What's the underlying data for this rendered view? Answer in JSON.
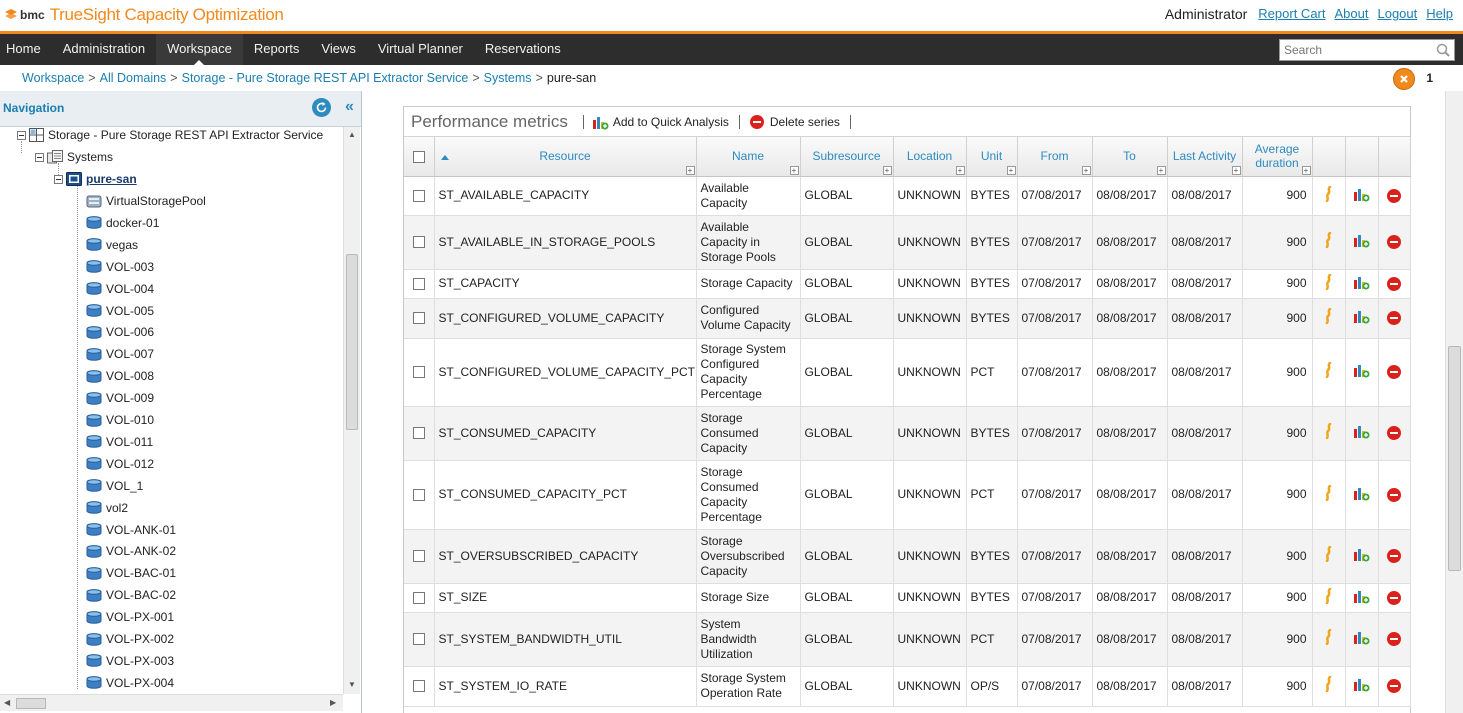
{
  "app": {
    "brand": "bmc",
    "product": "TrueSight Capacity Optimization",
    "user": "Administrator",
    "links": [
      "Report Cart",
      "About",
      "Logout",
      "Help"
    ]
  },
  "menu": {
    "items": [
      "Home",
      "Administration",
      "Workspace",
      "Reports",
      "Views",
      "Virtual Planner",
      "Reservations"
    ],
    "active": "Workspace",
    "search_placeholder": "Search"
  },
  "breadcrumb": {
    "items": [
      "Workspace",
      "All Domains",
      "Storage - Pure Storage REST API Extractor Service",
      "Systems"
    ],
    "current": "pure-san",
    "close_count": "1"
  },
  "nav": {
    "title": "Navigation",
    "domain": "Storage - Pure Storage REST API Extractor Service",
    "systems": "Systems",
    "selected": "pure-san",
    "children": [
      "VirtualStoragePool",
      "docker-01",
      "vegas",
      "VOL-003",
      "VOL-004",
      "VOL-005",
      "VOL-006",
      "VOL-007",
      "VOL-008",
      "VOL-009",
      "VOL-010",
      "VOL-011",
      "VOL-012",
      "VOL_1",
      "vol2",
      "VOL-ANK-01",
      "VOL-ANK-02",
      "VOL-BAC-01",
      "VOL-BAC-02",
      "VOL-PX-001",
      "VOL-PX-002",
      "VOL-PX-003",
      "VOL-PX-004"
    ]
  },
  "panel": {
    "title": "Performance metrics",
    "add_to_quick_analysis": "Add to Quick Analysis",
    "delete_series": "Delete series"
  },
  "table": {
    "headers": {
      "resource": "Resource",
      "name": "Name",
      "subresource": "Subresource",
      "location": "Location",
      "unit": "Unit",
      "from": "From",
      "to": "To",
      "last_activity": "Last Activity",
      "average_duration": "Average duration"
    },
    "rows": [
      {
        "resource": "ST_AVAILABLE_CAPACITY",
        "name": "Available Capacity",
        "subresource": "GLOBAL",
        "location": "UNKNOWN",
        "unit": "BYTES",
        "from": "07/08/2017",
        "to": "08/08/2017",
        "last": "08/08/2017",
        "dur": "900"
      },
      {
        "resource": "ST_AVAILABLE_IN_STORAGE_POOLS",
        "name": "Available Capacity in Storage Pools",
        "subresource": "GLOBAL",
        "location": "UNKNOWN",
        "unit": "BYTES",
        "from": "07/08/2017",
        "to": "08/08/2017",
        "last": "08/08/2017",
        "dur": "900"
      },
      {
        "resource": "ST_CAPACITY",
        "name": "Storage Capacity",
        "subresource": "GLOBAL",
        "location": "UNKNOWN",
        "unit": "BYTES",
        "from": "07/08/2017",
        "to": "08/08/2017",
        "last": "08/08/2017",
        "dur": "900"
      },
      {
        "resource": "ST_CONFIGURED_VOLUME_CAPACITY",
        "name": "Configured Volume Capacity",
        "subresource": "GLOBAL",
        "location": "UNKNOWN",
        "unit": "BYTES",
        "from": "07/08/2017",
        "to": "08/08/2017",
        "last": "08/08/2017",
        "dur": "900"
      },
      {
        "resource": "ST_CONFIGURED_VOLUME_CAPACITY_PCT",
        "name": "Storage System Configured Capacity Percentage",
        "subresource": "GLOBAL",
        "location": "UNKNOWN",
        "unit": "PCT",
        "from": "07/08/2017",
        "to": "08/08/2017",
        "last": "08/08/2017",
        "dur": "900"
      },
      {
        "resource": "ST_CONSUMED_CAPACITY",
        "name": "Storage Consumed Capacity",
        "subresource": "GLOBAL",
        "location": "UNKNOWN",
        "unit": "BYTES",
        "from": "07/08/2017",
        "to": "08/08/2017",
        "last": "08/08/2017",
        "dur": "900"
      },
      {
        "resource": "ST_CONSUMED_CAPACITY_PCT",
        "name": "Storage Consumed Capacity Percentage",
        "subresource": "GLOBAL",
        "location": "UNKNOWN",
        "unit": "PCT",
        "from": "07/08/2017",
        "to": "08/08/2017",
        "last": "08/08/2017",
        "dur": "900"
      },
      {
        "resource": "ST_OVERSUBSCRIBED_CAPACITY",
        "name": "Storage Oversubscribed Capacity",
        "subresource": "GLOBAL",
        "location": "UNKNOWN",
        "unit": "BYTES",
        "from": "07/08/2017",
        "to": "08/08/2017",
        "last": "08/08/2017",
        "dur": "900"
      },
      {
        "resource": "ST_SIZE",
        "name": "Storage Size",
        "subresource": "GLOBAL",
        "location": "UNKNOWN",
        "unit": "BYTES",
        "from": "07/08/2017",
        "to": "08/08/2017",
        "last": "08/08/2017",
        "dur": "900"
      },
      {
        "resource": "ST_SYSTEM_BANDWIDTH_UTIL",
        "name": "System Bandwidth Utilization",
        "subresource": "GLOBAL",
        "location": "UNKNOWN",
        "unit": "PCT",
        "from": "07/08/2017",
        "to": "08/08/2017",
        "last": "08/08/2017",
        "dur": "900"
      },
      {
        "resource": "ST_SYSTEM_IO_RATE",
        "name": "Storage System Operation Rate",
        "subresource": "GLOBAL",
        "location": "UNKNOWN",
        "unit": "OP/S",
        "from": "07/08/2017",
        "to": "08/08/2017",
        "last": "08/08/2017",
        "dur": "900"
      }
    ]
  },
  "colors": {
    "accent": "#f18a1c",
    "link": "#1a7fb0",
    "menubar": "#2d2d2d",
    "delete": "#d9221c"
  }
}
